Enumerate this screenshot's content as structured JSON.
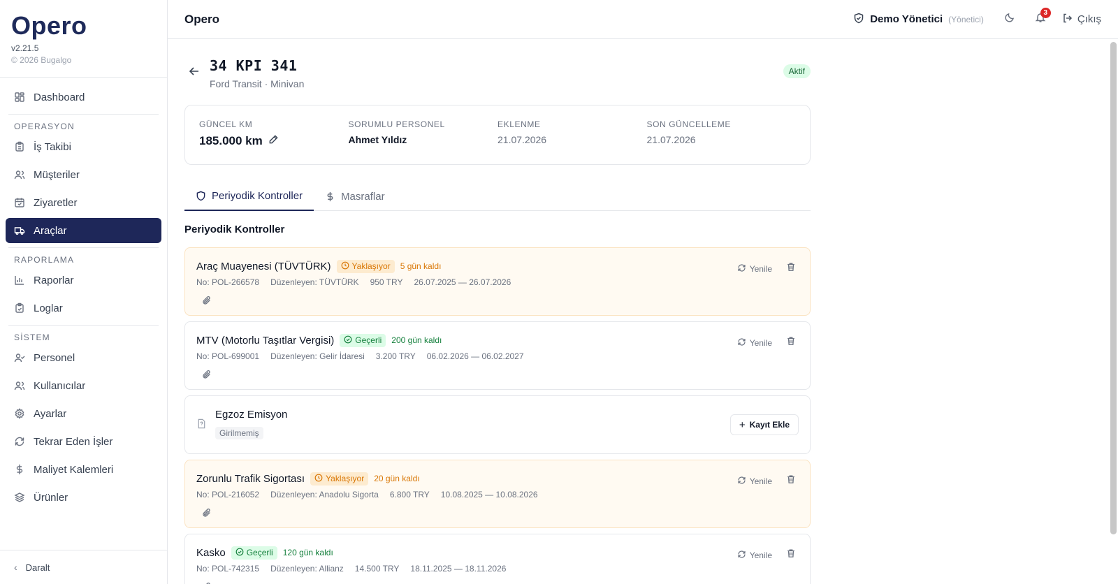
{
  "brand": {
    "logo": "Opero",
    "version": "v2.21.5",
    "copyright": "© 2026 Bugalgo"
  },
  "sidebar": {
    "dashboard": "Dashboard",
    "section_operation": "OPERASYON",
    "is_takibi": "İş Takibi",
    "musteriler": "Müşteriler",
    "ziyaretler": "Ziyaretler",
    "araclar": "Araçlar",
    "section_reporting": "RAPORLAMA",
    "raporlar": "Raporlar",
    "loglar": "Loglar",
    "section_system": "SİSTEM",
    "personel": "Personel",
    "kullanicilar": "Kullanıcılar",
    "ayarlar": "Ayarlar",
    "tekrar": "Tekrar Eden İşler",
    "maliyet": "Maliyet Kalemleri",
    "urunler": "Ürünler",
    "collapse": "Daralt"
  },
  "header": {
    "title": "Opero",
    "user_name": "Demo Yönetici",
    "user_role": "(Yönetici)",
    "notification_count": "3",
    "logout": "Çıkış"
  },
  "vehicle": {
    "plate": "34 KPI 341",
    "subtitle": "Ford Transit · Minivan",
    "status": "Aktif"
  },
  "stats": {
    "km_label": "GÜNCEL KM",
    "km_value": "185.000 km",
    "staff_label": "SORUMLU PERSONEL",
    "staff_value": "Ahmet Yıldız",
    "added_label": "EKLENME",
    "added_value": "21.07.2026",
    "updated_label": "SON GÜNCELLEME",
    "updated_value": "21.07.2026"
  },
  "tabs": {
    "periodic": "Periyodik Kontroller",
    "expenses": "Masraflar"
  },
  "section_title": "Periyodik Kontroller",
  "actions": {
    "renew": "Yenile",
    "add": "Kayıt Ekle"
  },
  "cards": [
    {
      "title": "Araç Muayenesi (TÜVTÜRK)",
      "status": "Yaklaşıyor",
      "days": "5 gün kaldı",
      "no": "No: POL-266578",
      "issuer": "Düzenleyen: TÜVTÜRK",
      "amount": "950 TRY",
      "period": "26.07.2025 — 26.07.2026"
    },
    {
      "title": "MTV (Motorlu Taşıtlar Vergisi)",
      "status": "Geçerli",
      "days": "200 gün kaldı",
      "no": "No: POL-699001",
      "issuer": "Düzenleyen: Gelir İdaresi",
      "amount": "3.200 TRY",
      "period": "06.02.2026 — 06.02.2027"
    },
    {
      "title": "Egzoz Emisyon",
      "status": "Girilmemiş"
    },
    {
      "title": "Zorunlu Trafik Sigortası",
      "status": "Yaklaşıyor",
      "days": "20 gün kaldı",
      "no": "No: POL-216052",
      "issuer": "Düzenleyen: Anadolu Sigorta",
      "amount": "6.800 TRY",
      "period": "10.08.2025 — 10.08.2026"
    },
    {
      "title": "Kasko",
      "status": "Geçerli",
      "days": "120 gün kaldı",
      "no": "No: POL-742315",
      "issuer": "Düzenleyen: Allianz",
      "amount": "14.500 TRY",
      "period": "18.11.2025 — 18.11.2026"
    }
  ]
}
